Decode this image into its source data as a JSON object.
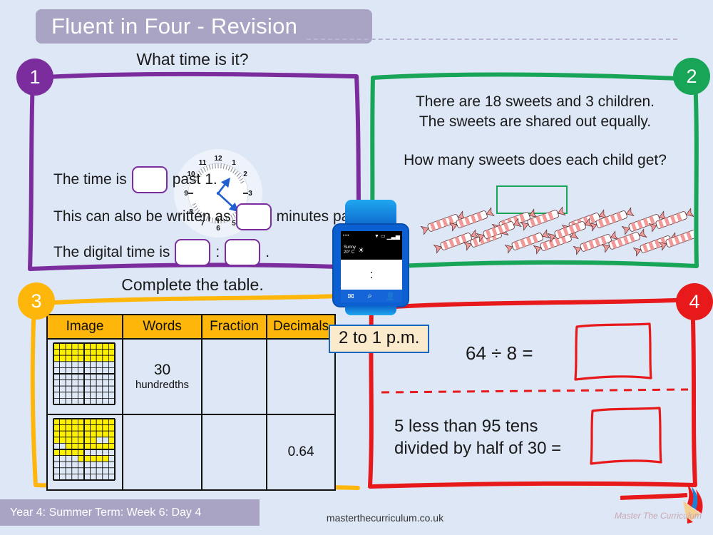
{
  "header": {
    "title": "Fluent in Four - Revision"
  },
  "footer": {
    "lesson_label": "Year 4: Summer Term: Week 6: Day 4",
    "website": "masterthecurriculum.co.uk",
    "logo_script": "Master The Curriculum"
  },
  "colors": {
    "background": "#dde7f5",
    "banner_purple": "#a9a3c4",
    "panel1_purple": "#7b2d9e",
    "panel2_green": "#18a558",
    "panel3_amber": "#ffb60a",
    "panel4_red": "#e8191b",
    "grid_yellow": "#ffef00",
    "watch_blue": "#0b5fd0",
    "tooltip_cream": "#fbeacb"
  },
  "questions": [
    {
      "number": "1",
      "accent": "#7b2d9e",
      "heading": "What time is it?",
      "clock": {
        "hour_hand_value": 1,
        "minute_hand_value": 19,
        "numerals": [
          "12",
          "1",
          "2",
          "3",
          "4",
          "5",
          "6",
          "7",
          "8",
          "9",
          "10",
          "11"
        ],
        "hand_color": "#1f5fd0"
      },
      "lines": [
        {
          "before": "The time is",
          "after": "past 1.",
          "boxes": 1
        },
        {
          "before": "This can also be written as",
          "after": "minutes past 1.",
          "boxes": 1
        },
        {
          "before": "The digital time is",
          "separator": ":",
          "after": ".",
          "boxes": 2
        }
      ]
    },
    {
      "number": "2",
      "accent": "#18a558",
      "text_line_1": "There are 18 sweets and 3 children.",
      "text_line_2": "The sweets are shared out equally.",
      "question": "How many sweets does each child get?",
      "answer_value": "",
      "sweet_count": 18
    },
    {
      "number": "3",
      "accent": "#ffb60a",
      "heading": "Complete the table.",
      "table": {
        "columns": [
          "Image",
          "Words",
          "Fraction",
          "Decimals"
        ],
        "rows": [
          {
            "image": "hundredths-grid-30",
            "shaded": 30,
            "words_main": "30",
            "words_sub": "hundredths",
            "fraction": "",
            "decimal": ""
          },
          {
            "image": "hundredths-grid-64",
            "shaded": 64,
            "words_main": "",
            "words_sub": "",
            "fraction": "",
            "decimal": "0.64"
          }
        ]
      }
    },
    {
      "number": "4",
      "accent": "#e8191b",
      "problem_1": "64 ÷ 8 =",
      "problem_1_answer": "",
      "problem_2_line_1": "5 less than 95 tens",
      "problem_2_line_2": "divided by half of 30 =",
      "problem_2_answer": ""
    }
  ],
  "watch": {
    "weather_condition": "Sunny",
    "temperature": "20° C",
    "screen_time": ":",
    "nav_icons": [
      "envelope-icon",
      "search-icon",
      "person-icon"
    ],
    "status_icons": [
      "wifi-icon",
      "battery-icon",
      "signal-icon"
    ],
    "tooltip": "2 to 1 p.m."
  },
  "grids": {
    "row1_shaded_cells": [
      0,
      1,
      2,
      3,
      4,
      5,
      6,
      7,
      8,
      9,
      10,
      11,
      12,
      13,
      14,
      15,
      16,
      17,
      18,
      19,
      20,
      21,
      22,
      23,
      24,
      25,
      26,
      27,
      28,
      29
    ],
    "row2_shaded_cells": [
      0,
      1,
      2,
      3,
      4,
      5,
      6,
      7,
      8,
      9,
      10,
      11,
      12,
      13,
      14,
      15,
      16,
      17,
      18,
      19,
      20,
      21,
      22,
      23,
      24,
      25,
      26,
      27,
      28,
      29,
      30,
      31,
      32,
      33,
      34,
      35,
      36,
      39,
      42,
      43,
      44,
      45,
      46,
      47,
      48,
      49,
      50,
      51,
      52,
      53,
      54,
      64,
      65,
      66,
      67,
      68
    ]
  }
}
